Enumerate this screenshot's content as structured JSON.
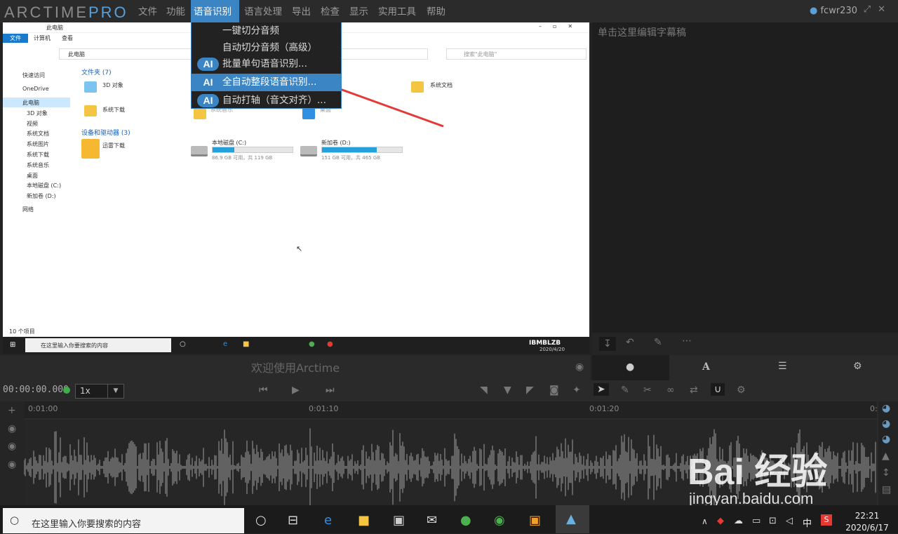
{
  "app": {
    "logo_main": "ARCTIME",
    "logo_pro": "PRO",
    "user": "fcwr230"
  },
  "menubar": [
    {
      "label": "文件"
    },
    {
      "label": "功能"
    },
    {
      "label": "语音识别"
    },
    {
      "label": "语言处理"
    },
    {
      "label": "导出"
    },
    {
      "label": "检查"
    },
    {
      "label": "显示"
    },
    {
      "label": "实用工具"
    },
    {
      "label": "帮助"
    }
  ],
  "dropdown": {
    "items": [
      {
        "label": "一键切分音频",
        "ai": ""
      },
      {
        "label": "自动切分音频（高级）",
        "ai": ""
      },
      {
        "label": "批量单句语音识别...",
        "ai": "AI"
      },
      {
        "label": "全自动整段语音识别...",
        "ai": "AI"
      },
      {
        "label": "自动打轴（音文对齐）...",
        "ai": "AI"
      }
    ]
  },
  "right_panel": {
    "placeholder": "单击这里编辑字幕稿"
  },
  "welcome": "欢迎使用Arctime",
  "transport": {
    "timecode": "00:00:00.000",
    "speed": "1x"
  },
  "ruler": {
    "ticks": [
      "0:01:00",
      "0:01:10",
      "0:01:20",
      "0:"
    ]
  },
  "explorer": {
    "title": "此电脑",
    "tabs": [
      "文件",
      "计算机",
      "查看"
    ],
    "address": "此电脑",
    "search_placeholder": "搜索\"此电脑\"",
    "sidebar": [
      "快速访问",
      "OneDrive",
      "此电脑",
      "3D 对象",
      "视频",
      "系统文档",
      "系统图片",
      "系统下载",
      "系统音乐",
      "桌面",
      "本地磁盘 (C:)",
      "新加卷 (D:)",
      "网络"
    ],
    "folders_header": "文件夹 (7)",
    "folders": [
      "3D 对象",
      "系统文档",
      "系统下载",
      "系统音乐",
      "桌面"
    ],
    "drives_header": "设备和驱动器 (3)",
    "drives": [
      {
        "name": "迅雷下载",
        "free": ""
      },
      {
        "name": "本地磁盘 (C:)",
        "free": "86.9 GB 可用，共 119 GB"
      },
      {
        "name": "新加卷 (D:)",
        "free": "151 GB 可用，共 465 GB"
      }
    ],
    "status": "10 个项目",
    "taskbar_search": "在这里输入你要搜索的内容",
    "clock_date": "2020/4/20"
  },
  "taskbar": {
    "search": "在这里输入你要搜索的内容",
    "time": "22:21",
    "date": "2020/6/17",
    "ime": "中"
  },
  "watermark": {
    "line1": "Bai 经验",
    "line2": "jingyan.baidu.com"
  }
}
